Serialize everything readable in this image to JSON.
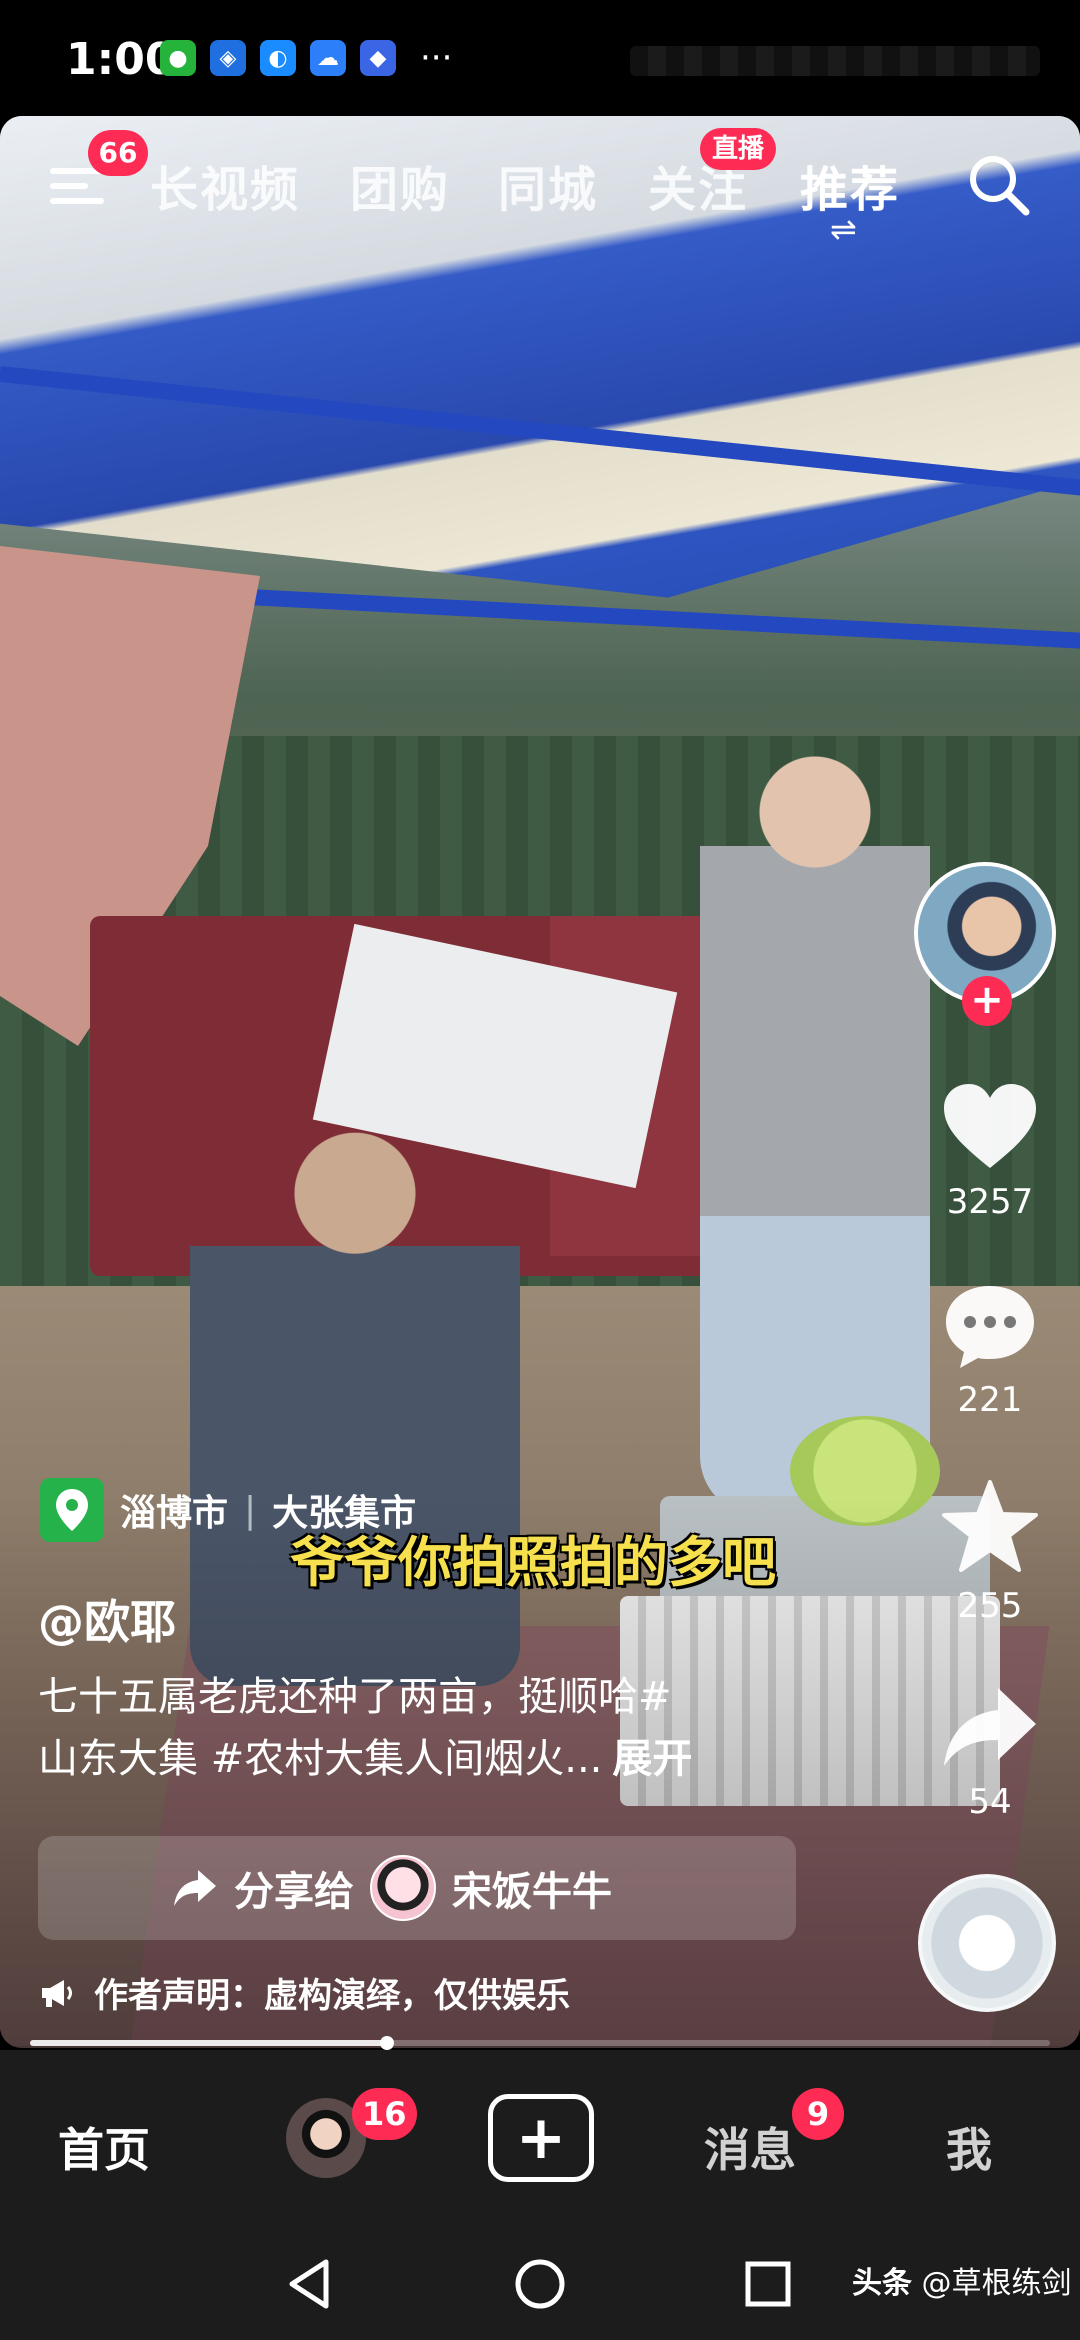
{
  "status_bar": {
    "time": "1:00",
    "more": "···",
    "icons": [
      "wechat-icon",
      "app-icon",
      "browser-icon",
      "cloud-icon",
      "app-store-icon"
    ]
  },
  "top_nav": {
    "menu_badge": "66",
    "tabs": [
      "长视频",
      "团购",
      "同城",
      "关注",
      "推荐"
    ],
    "active_tab": "推荐",
    "live_badge": "直播",
    "swap_glyph": "⇌"
  },
  "video": {
    "subtitle": "爷爷你拍照拍的多吧",
    "location": {
      "city": "淄博市",
      "place": "大张集市",
      "separator": "|"
    },
    "author": "@欧耶",
    "description_line1": "七十五属老虎还种了两亩，挺顺哈#",
    "description_line2": "山东大集 #农村大集人间烟火...",
    "expand_label": "展开",
    "share": {
      "label": "分享给",
      "friend": "宋饭牛牛"
    },
    "disclaimer": "作者声明：虚构演绎，仅供娱乐",
    "progress": 0.35
  },
  "side_actions": {
    "follow_plus": "+",
    "likes": "3257",
    "comments": "221",
    "favorites": "255",
    "shares": "54"
  },
  "bottom_tabs": {
    "home": "首页",
    "friends_badge": "16",
    "create": "+",
    "messages": "消息",
    "messages_badge": "9",
    "me": "我"
  },
  "watermark": {
    "source": "头条",
    "handle": "@草根练剑"
  },
  "colors": {
    "accent_red": "#fe2c55",
    "subtitle_yellow": "#f6e04d",
    "location_green": "#26b24b",
    "tabbar_bg": "#1c1c1c"
  }
}
